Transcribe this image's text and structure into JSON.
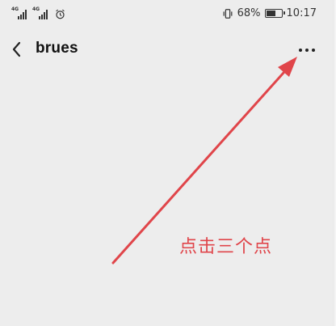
{
  "status_bar": {
    "network_1": "4G",
    "network_2": "4G",
    "battery_percent": "68%",
    "battery_level": 0.68,
    "time": "10:17"
  },
  "title_bar": {
    "title": "brues"
  },
  "annotation": {
    "text": "点击三个点",
    "color": "#e0454a"
  },
  "icons": {
    "back": "back-chevron-icon",
    "more": "more-dots-icon",
    "alarm": "alarm-clock-icon",
    "vibrate": "vibrate-icon",
    "battery": "battery-icon",
    "signal": "signal-icon"
  }
}
